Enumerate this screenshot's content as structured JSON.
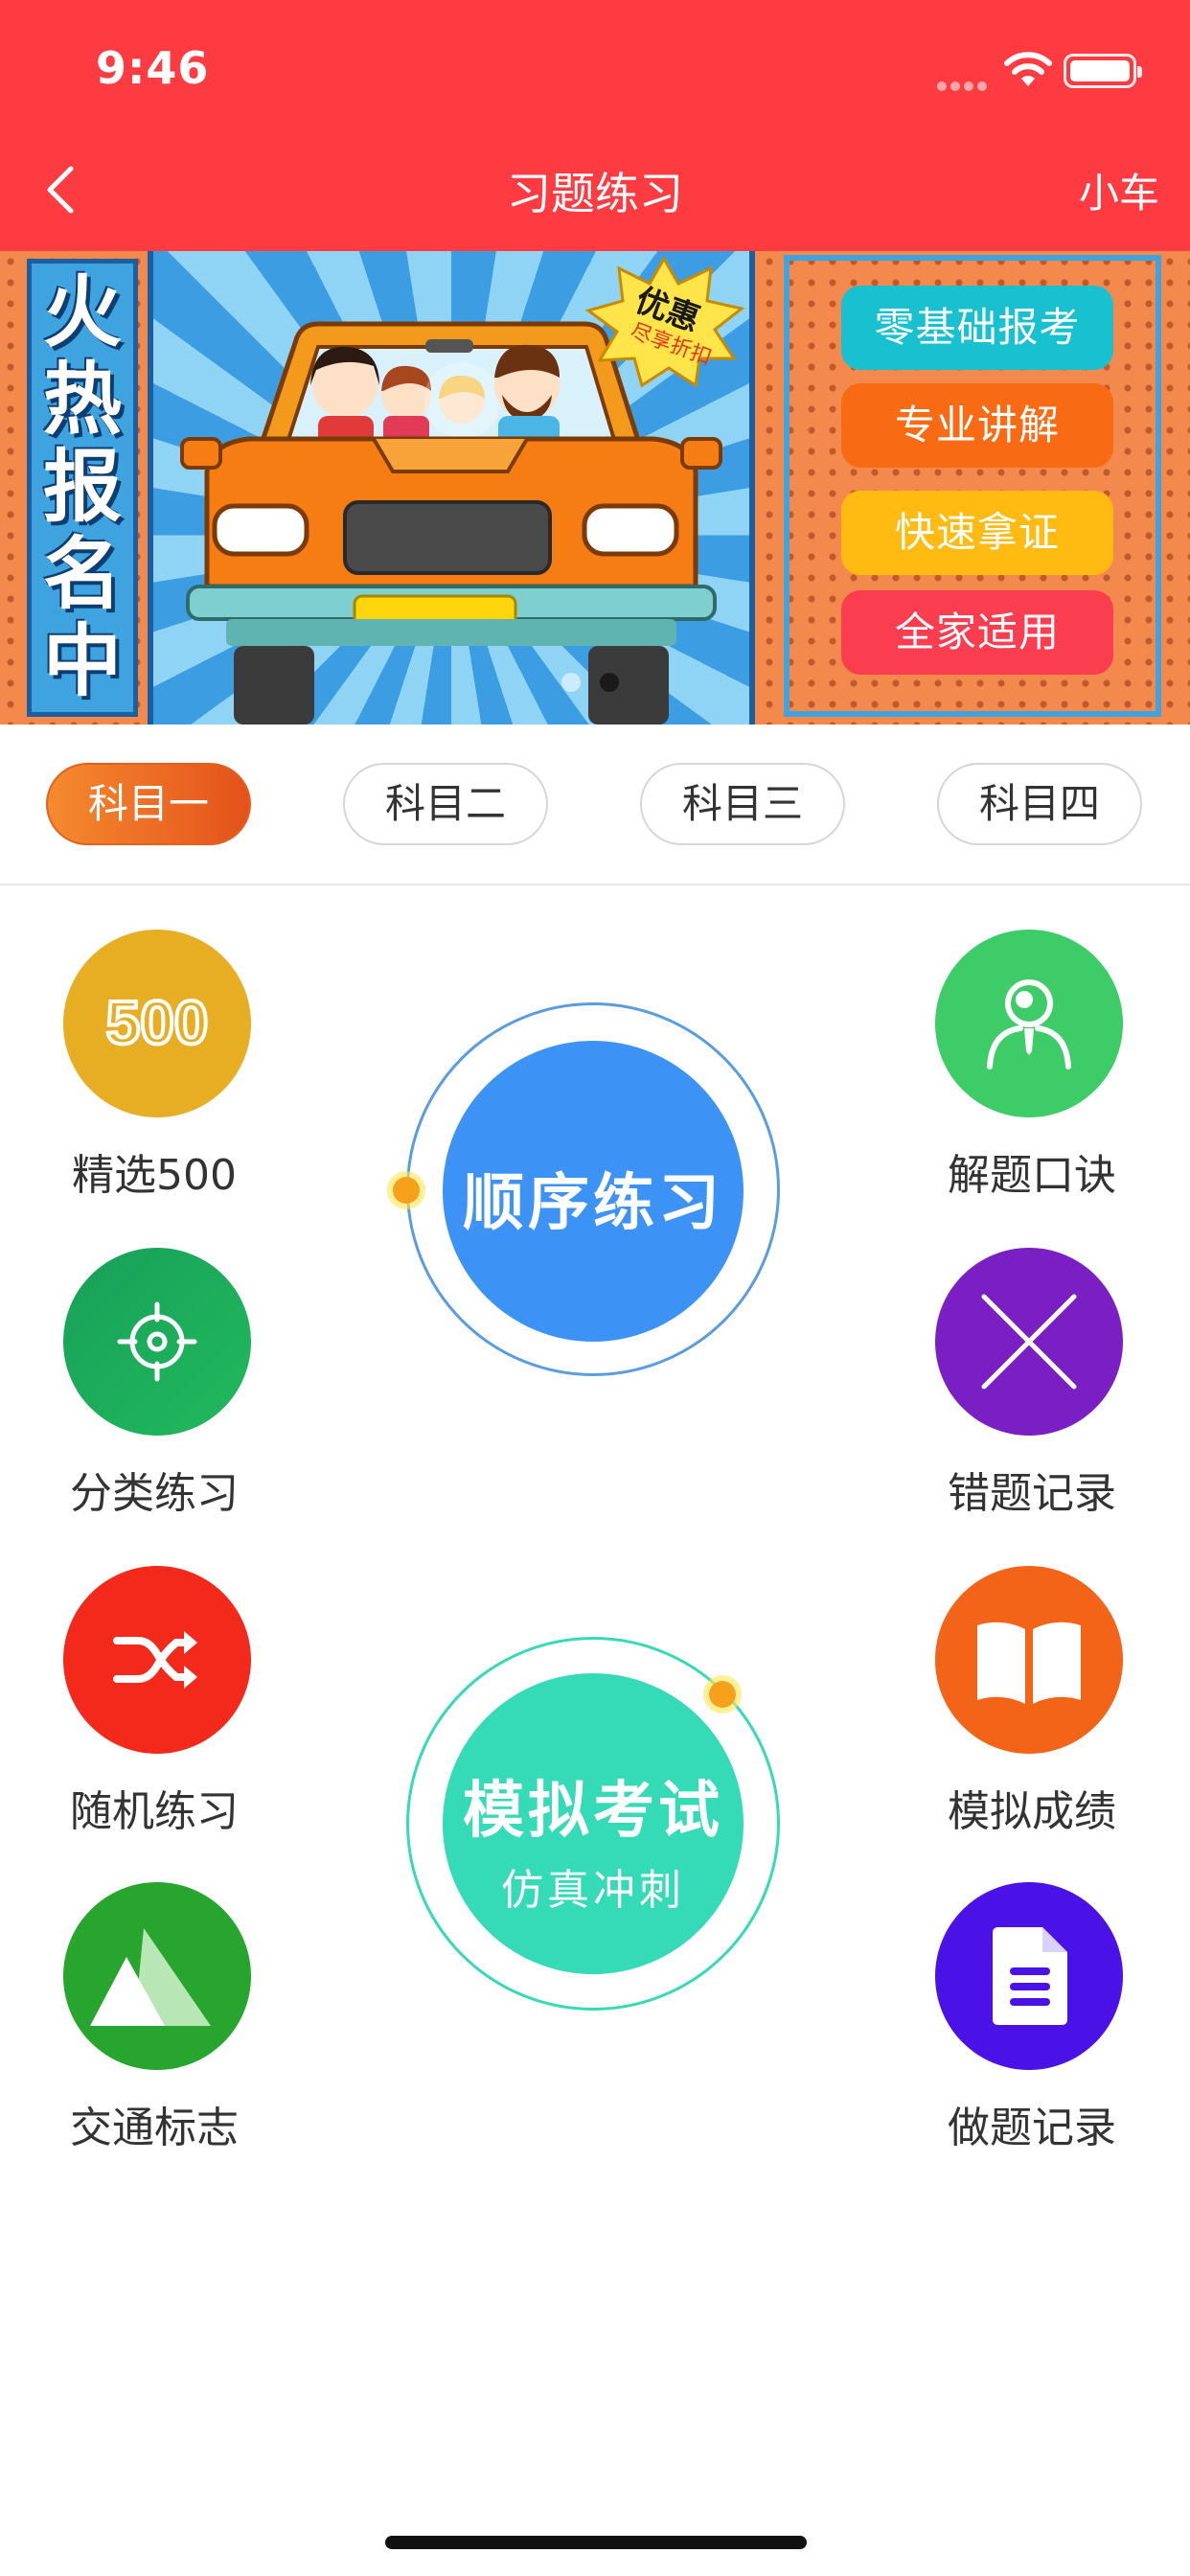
{
  "status_bar": {
    "time": "9:46"
  },
  "nav": {
    "title": "习题练习",
    "right_label": "小车",
    "back_icon": "chevron-left-icon"
  },
  "banner": {
    "vertical_text": [
      "火",
      "热",
      "报",
      "名",
      "中"
    ],
    "promo_badge": {
      "line1": "优惠",
      "line2": "尽享折扣"
    },
    "tags": [
      "零基础报考",
      "专业讲解",
      "快速拿证",
      "全家适用"
    ],
    "page_count": 2,
    "active_page": 2
  },
  "tabs": [
    {
      "label": "科目一",
      "active": true
    },
    {
      "label": "科目二",
      "active": false
    },
    {
      "label": "科目三",
      "active": false
    },
    {
      "label": "科目四",
      "active": false
    }
  ],
  "left_items": [
    {
      "label": "精选500",
      "icon": "500-badge-icon",
      "color": "#e8ae23"
    },
    {
      "label": "分类练习",
      "icon": "target-icon",
      "color": "#1aa95a"
    },
    {
      "label": "随机练习",
      "icon": "shuffle-icon",
      "color": "#f2291b"
    },
    {
      "label": "交通标志",
      "icon": "mountain-sign-icon",
      "color": "#27a52e"
    }
  ],
  "right_items": [
    {
      "label": "解题口诀",
      "icon": "person-icon",
      "color": "#3dcc68"
    },
    {
      "label": "错题记录",
      "icon": "cross-icon",
      "color": "#7a1fc4"
    },
    {
      "label": "模拟成绩",
      "icon": "book-icon",
      "color": "#f46418"
    },
    {
      "label": "做题记录",
      "icon": "document-icon",
      "color": "#4b12e8"
    }
  ],
  "center": {
    "sequential": {
      "label": "顺序练习",
      "color": "#3d93f5"
    },
    "exam": {
      "label": "模拟考试",
      "sublabel": "仿真冲刺",
      "color": "#35dab6"
    }
  }
}
